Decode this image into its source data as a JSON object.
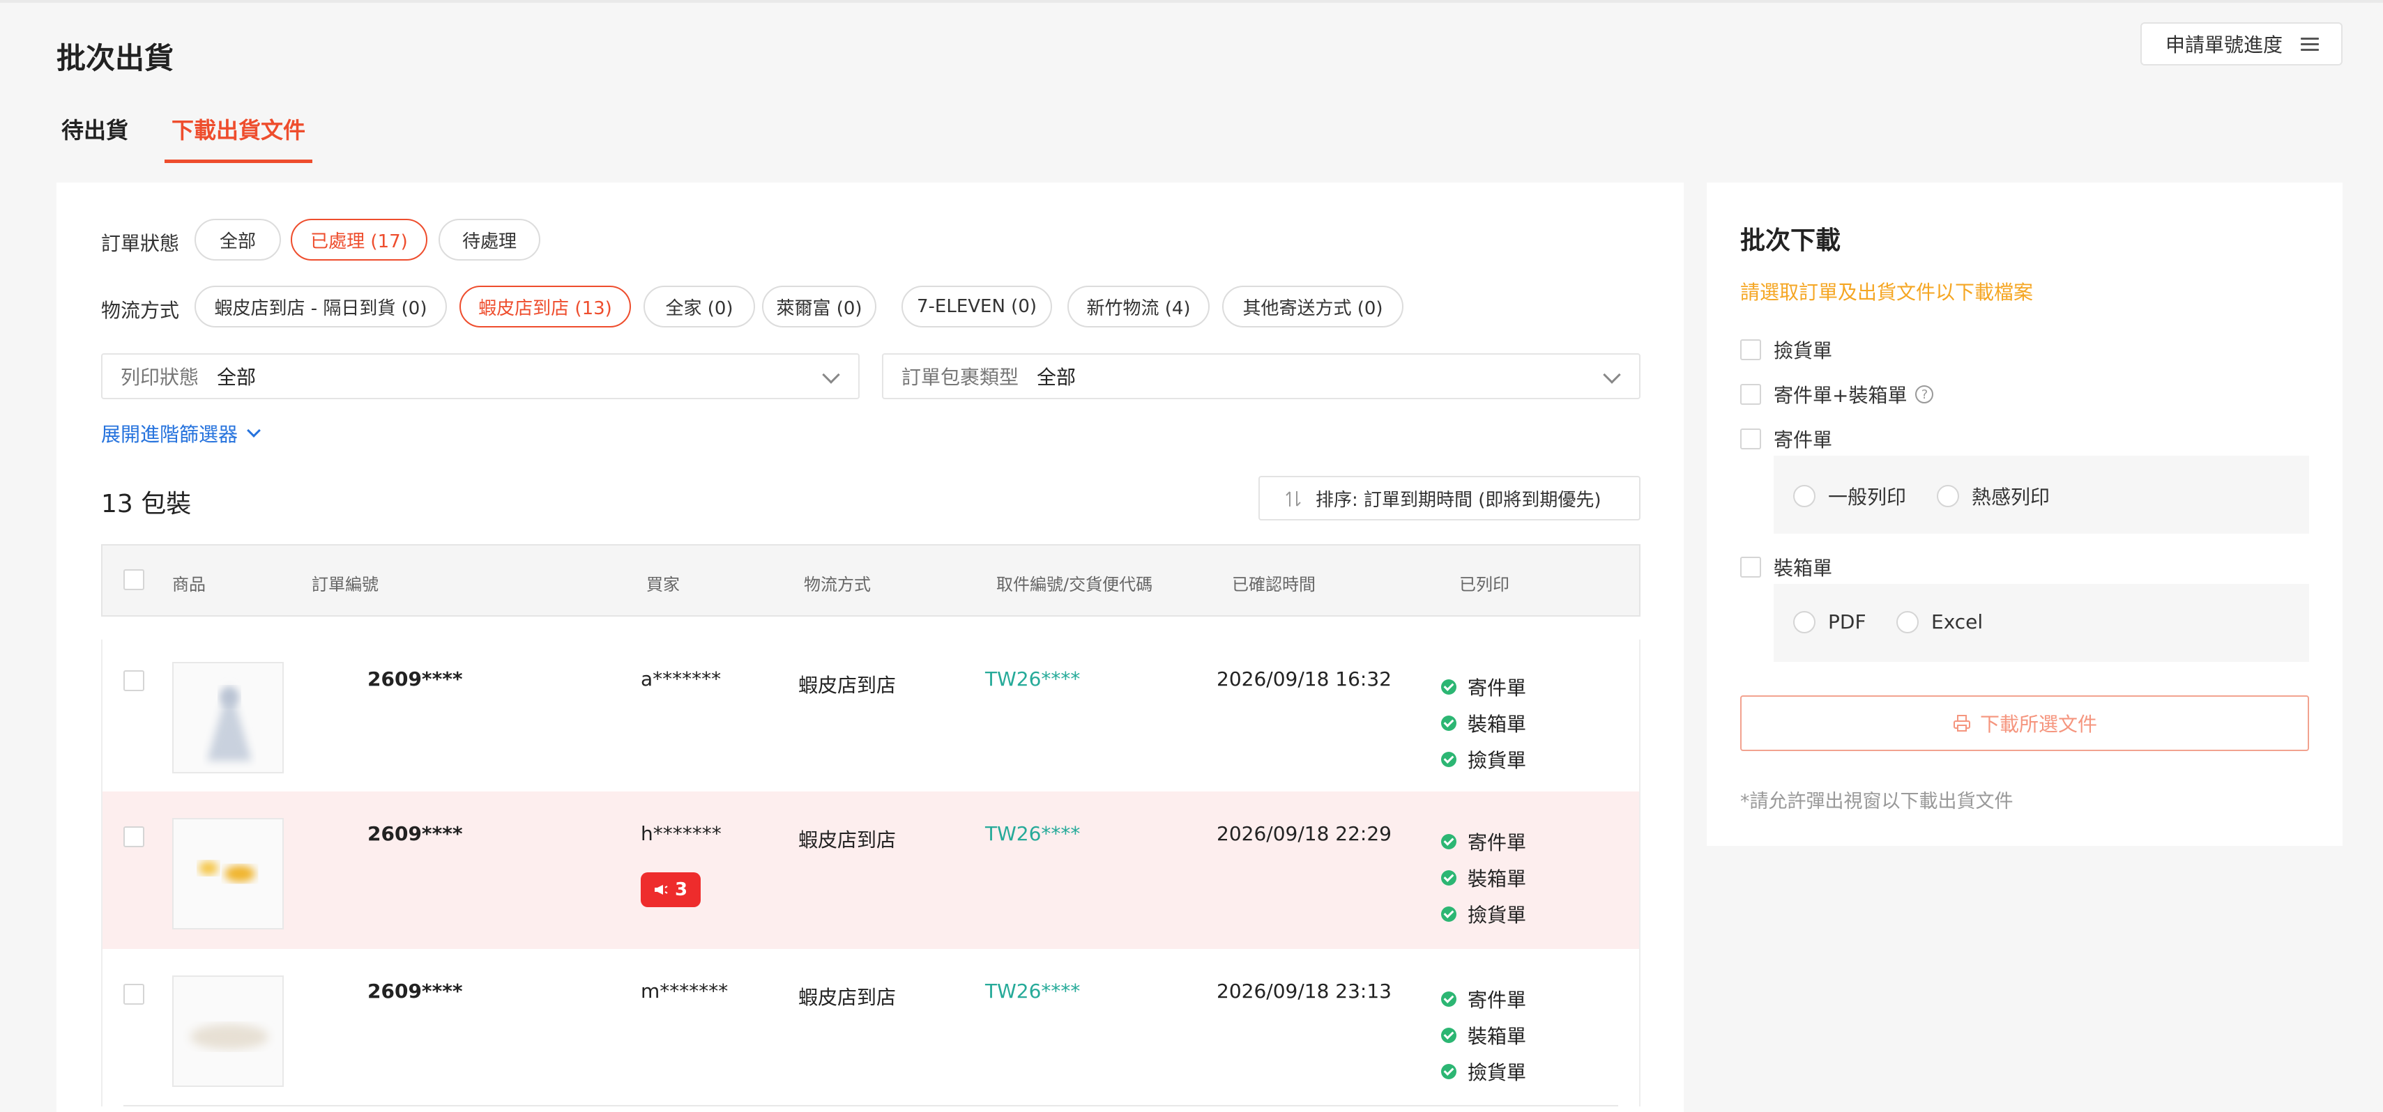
{
  "header": {
    "title": "批次出貨",
    "progress_button": "申請單號進度"
  },
  "tabs": [
    {
      "label": "待出貨",
      "active": false
    },
    {
      "label": "下載出貨文件",
      "active": true
    }
  ],
  "filters": {
    "order_status_label": "訂單狀態",
    "order_status": [
      "全部",
      "已處理 (17)",
      "待處理"
    ],
    "order_status_selected": "已處理 (17)",
    "logistics_label": "物流方式",
    "logistics": [
      "蝦皮店到店 - 隔日到貨 (0)",
      "蝦皮店到店 (13)",
      "全家 (0)",
      "萊爾富 (0)",
      "7-ELEVEN (0)",
      "新竹物流 (4)",
      "其他寄送方式 (0)"
    ],
    "logistics_selected": "蝦皮店到店 (13)",
    "print_status_label": "列印狀態",
    "print_status_value": "全部",
    "package_type_label": "訂單包裹類型",
    "package_type_value": "全部",
    "expand_label": "展開進階篩選器"
  },
  "list": {
    "count_text": "13 包裝",
    "sort_label": "排序: 訂單到期時間 (即將到期優先)",
    "columns": [
      "商品",
      "訂單編號",
      "買家",
      "物流方式",
      "取件編號/交貨便代碼",
      "已確認時間",
      "已列印"
    ],
    "rows": [
      {
        "order": "2609****",
        "buyer": "a*******",
        "shipping": "蝦皮店到店",
        "tracking": "TW26****",
        "time": "2026/09/18 16:32",
        "printed": [
          "寄件單",
          "裝箱單",
          "撿貨單"
        ],
        "badge": ""
      },
      {
        "order": "2609****",
        "buyer": "h*******",
        "shipping": "蝦皮店到店",
        "tracking": "TW26****",
        "time": "2026/09/18 22:29",
        "printed": [
          "寄件單",
          "裝箱單",
          "撿貨單"
        ],
        "badge": "3"
      },
      {
        "order": "2609****",
        "buyer": "m*******",
        "shipping": "蝦皮店到店",
        "tracking": "TW26****",
        "time": "2026/09/18 23:13",
        "printed": [
          "寄件單",
          "裝箱單",
          "撿貨單"
        ],
        "badge": ""
      }
    ]
  },
  "side": {
    "title": "批次下載",
    "hint": "請選取訂單及出貨文件以下載檔案",
    "options": {
      "picking": "撿貨單",
      "shipping_packing": "寄件單+裝箱單",
      "shipping": "寄件單",
      "shipping_radios": [
        "一般列印",
        "熱感列印"
      ],
      "packing": "裝箱單",
      "packing_radios": [
        "PDF",
        "Excel"
      ]
    },
    "download_button": "下載所選文件",
    "note": "*請允許彈出視窗以下載出貨文件"
  },
  "colors": {
    "accent": "#ee4d2d",
    "link": "#2673dd",
    "tracking": "#26aa99",
    "hint": "#f5a623",
    "success": "#2cb673"
  }
}
